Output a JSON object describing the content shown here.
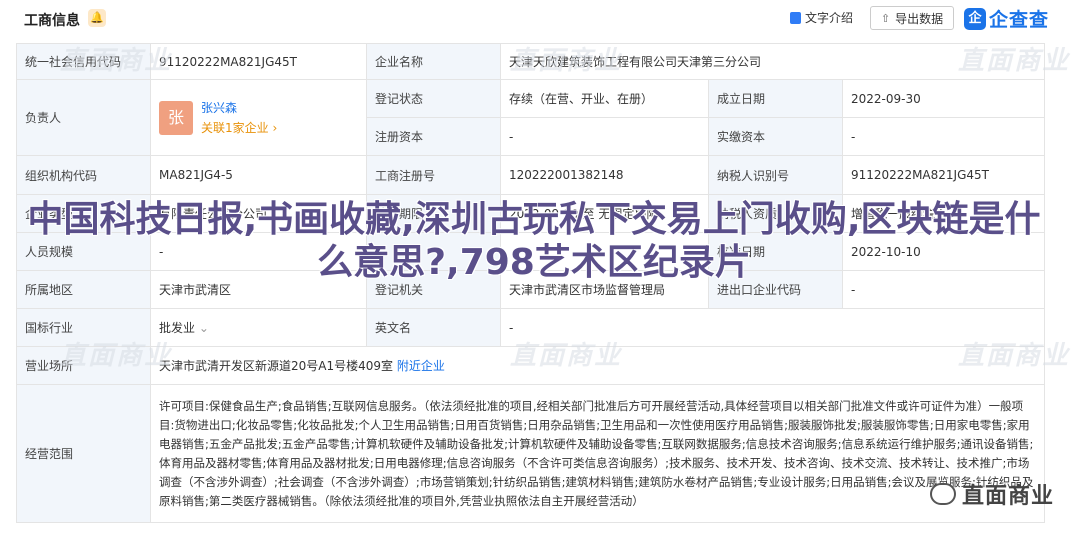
{
  "header": {
    "title": "工商信息",
    "bell_icon": "bell-icon",
    "intro_label": "文字介绍",
    "export_label": "导出数据",
    "logo_badge": "企",
    "logo_text": "企查查"
  },
  "table": {
    "credit_code_label": "统一社会信用代码",
    "credit_code_value": "91120222MA821JG45T",
    "company_name_label": "企业名称",
    "company_name_value": "天津天欣建筑装饰工程有限公司天津第三分公司",
    "legal_person_label": "负责人",
    "avatar_char": "张",
    "legal_person_name": "张兴森",
    "legal_person_assoc": "关联1家企业 ›",
    "status_label": "登记状态",
    "status_value": "存续（在营、开业、在册）",
    "established_label": "成立日期",
    "established_value": "2022-09-30",
    "reg_capital_label": "注册资本",
    "reg_capital_value": "-",
    "paid_capital_label": "实缴资本",
    "paid_capital_value": "-",
    "org_code_label": "组织机构代码",
    "org_code_value": "MA821JG4-5",
    "biz_reg_no_label": "工商注册号",
    "biz_reg_no_value": "120222001382148",
    "taxpayer_id_label": "纳税人识别号",
    "taxpayer_id_value": "91120222MA821JG45T",
    "company_type_label": "企业类型",
    "company_type_value": "有限责任公司分公司",
    "biz_term_label": "营业期限",
    "biz_term_value": "2022-09-30 至 无固定期限",
    "taxpayer_qual_label": "纳税人资质",
    "taxpayer_qual_value": "增值税一般纳税人",
    "staff_size_label": "人员规模",
    "staff_size_value": "-",
    "approved_date_label": "核准日期",
    "approved_date_value": "2022-10-10",
    "region_label": "所属地区",
    "region_value": "天津市武清区",
    "reg_authority_label": "登记机关",
    "reg_authority_value": "天津市武清区市场监督管理局",
    "import_export_label": "进出口企业代码",
    "import_export_value": "-",
    "industry_label": "国标行业",
    "industry_value": "批发业",
    "english_name_label": "英文名",
    "english_name_value": "-",
    "address_label": "营业场所",
    "address_value": "天津市武清开发区新源道20号A1号楼409室",
    "nearby_label": "附近企业",
    "scope_label": "经营范围",
    "scope_value": "许可项目:保健食品生产;食品销售;互联网信息服务。（依法须经批准的项目,经相关部门批准后方可开展经营活动,具体经营项目以相关部门批准文件或许可证件为准）一般项目:货物进出口;化妆品零售;化妆品批发;个人卫生用品销售;日用百货销售;日用杂品销售;卫生用品和一次性使用医疗用品销售;服装服饰批发;服装服饰零售;日用家电零售;家用电器销售;五金产品批发;五金产品零售;计算机软硬件及辅助设备批发;计算机软硬件及辅助设备零售;互联网数据服务;信息技术咨询服务;信息系统运行维护服务;通讯设备销售;体育用品及器材零售;体育用品及器材批发;日用电器修理;信息咨询服务（不含许可类信息咨询服务）;技术服务、技术开发、技术咨询、技术交流、技术转让、技术推广;市场调查（不含涉外调查）;社会调查（不含涉外调查）;市场营销策划;针纺织品销售;建筑材料销售;建筑防水卷材产品销售;专业设计服务;日用品销售;会议及展览服务;针纺织品及原料销售;第二类医疗器械销售。（除依法须经批准的项目外,凭营业执照依法自主开展经营活动）"
  },
  "overlay": {
    "watermark": "直面商业",
    "headline": "中国科技日报,书画收藏,深圳古玩私下交易上门收购,区块链是什么意思?,798艺术区纪录片",
    "wechat_label": "直面商业",
    "wechat_icon": "wechat-icon"
  }
}
